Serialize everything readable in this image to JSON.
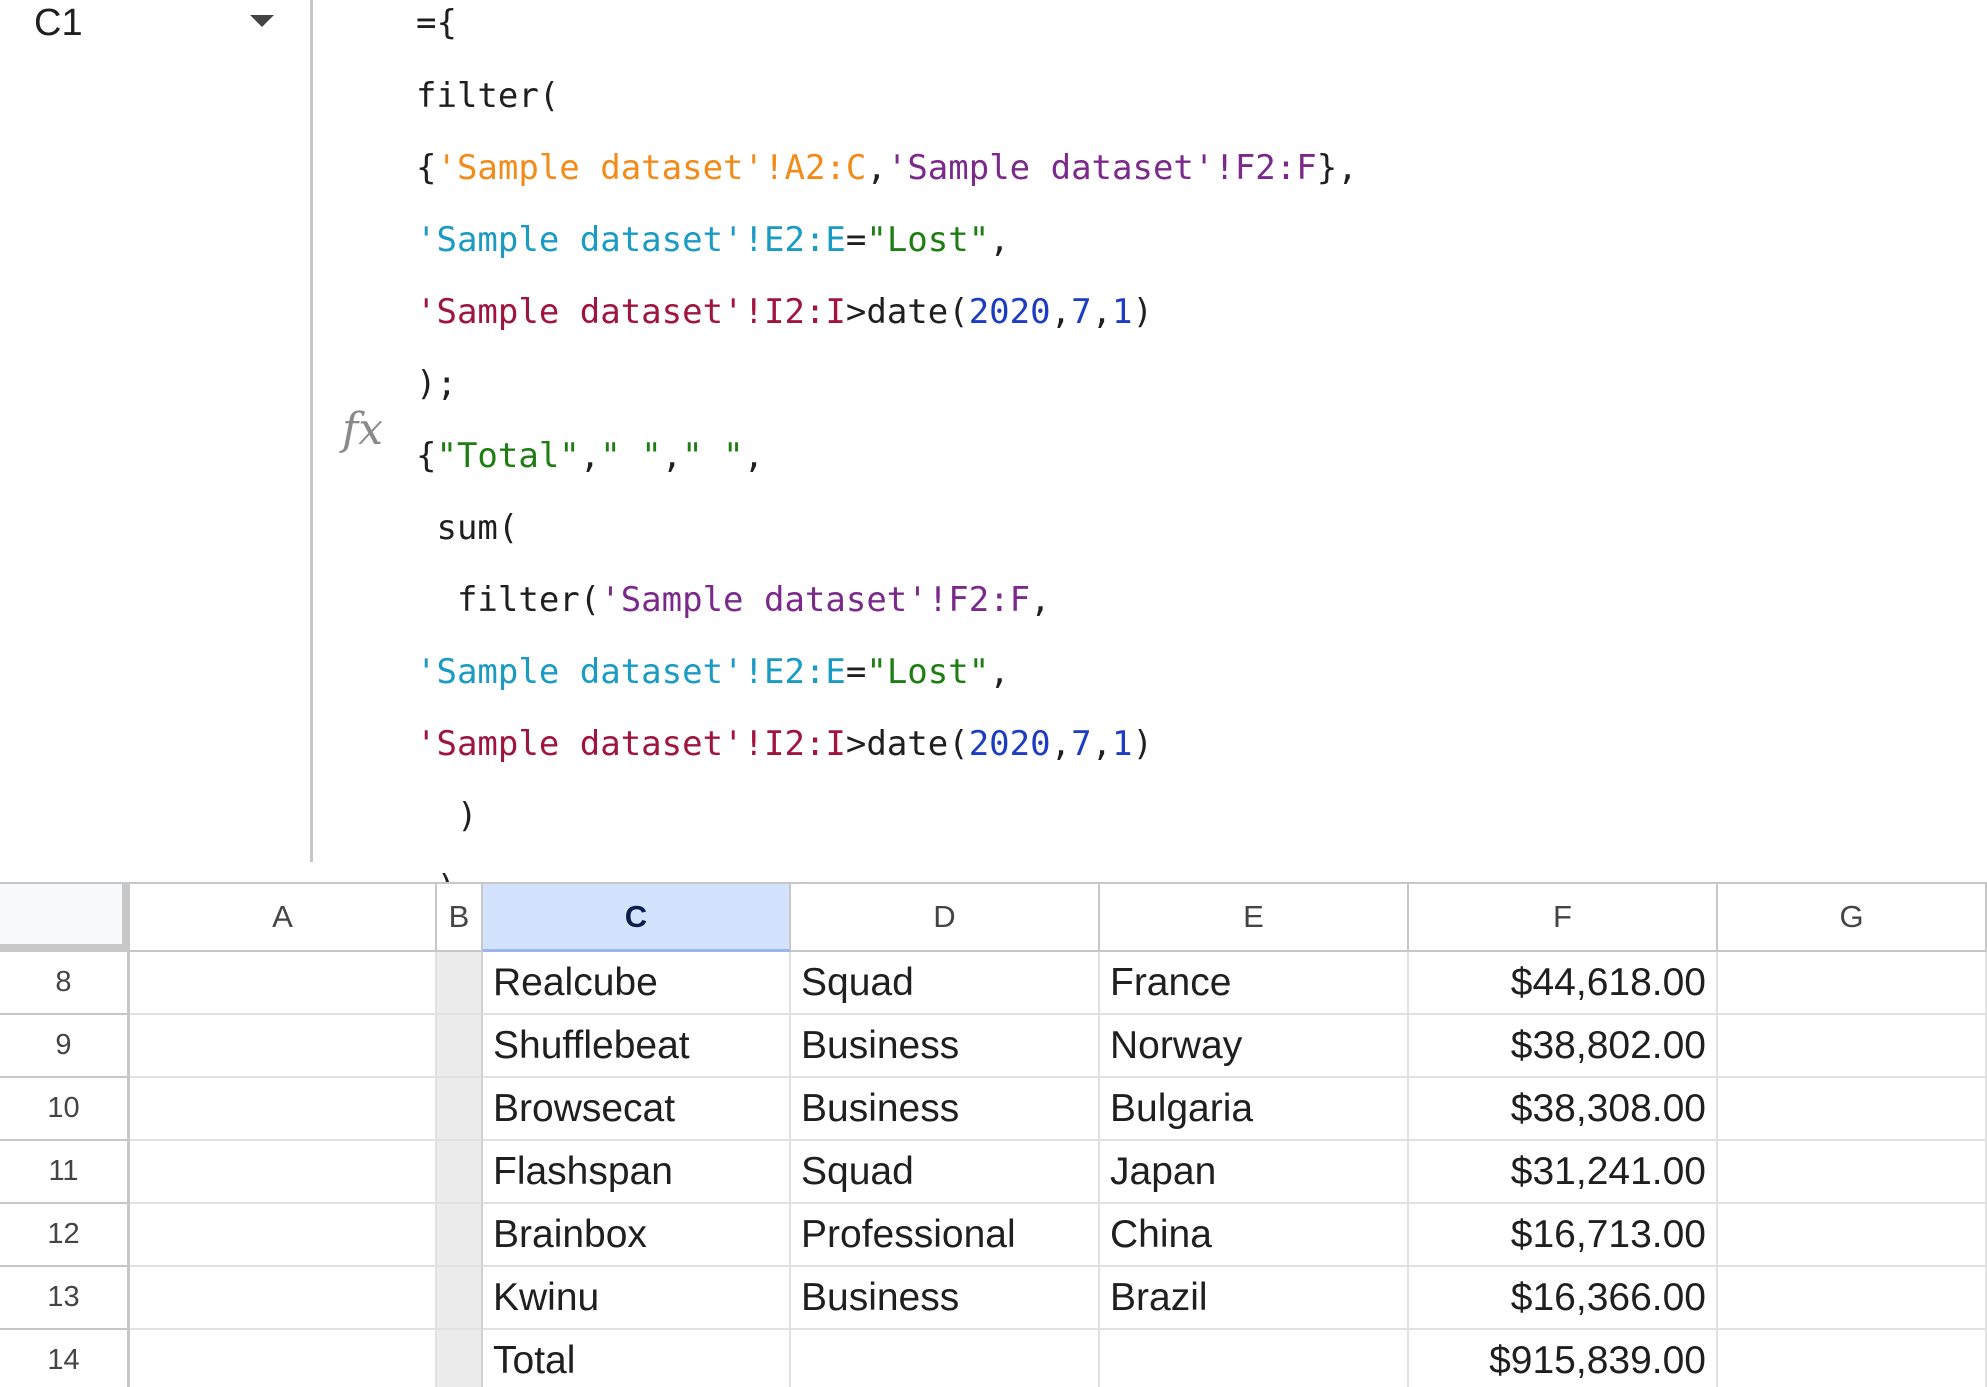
{
  "name_box": {
    "cell_ref": "C1"
  },
  "formula_bar": {
    "fx_icon": "fx",
    "lines": [
      [
        {
          "t": "={",
          "c": "black"
        }
      ],
      [
        {
          "t": "filter(",
          "c": "black"
        }
      ],
      [
        {
          "t": "{",
          "c": "black"
        },
        {
          "t": "'Sample dataset'!A2:C",
          "c": "orange"
        },
        {
          "t": ",",
          "c": "black"
        },
        {
          "t": "'Sample dataset'!F2:F",
          "c": "purple"
        },
        {
          "t": "},",
          "c": "black"
        }
      ],
      [
        {
          "t": "'Sample dataset'!E2:E",
          "c": "teal"
        },
        {
          "t": "=",
          "c": "black"
        },
        {
          "t": "\"Lost\"",
          "c": "green"
        },
        {
          "t": ",",
          "c": "black"
        }
      ],
      [
        {
          "t": "'Sample dataset'!I2:I",
          "c": "maroon"
        },
        {
          "t": ">date(",
          "c": "black"
        },
        {
          "t": "2020",
          "c": "blue"
        },
        {
          "t": ",",
          "c": "black"
        },
        {
          "t": "7",
          "c": "blue"
        },
        {
          "t": ",",
          "c": "black"
        },
        {
          "t": "1",
          "c": "blue"
        },
        {
          "t": ")",
          "c": "black"
        }
      ],
      [
        {
          "t": ");",
          "c": "black"
        }
      ],
      [
        {
          "t": "{",
          "c": "black"
        },
        {
          "t": "\"Total\"",
          "c": "green"
        },
        {
          "t": ",",
          "c": "black"
        },
        {
          "t": "\" \"",
          "c": "green"
        },
        {
          "t": ",",
          "c": "black"
        },
        {
          "t": "\" \"",
          "c": "green"
        },
        {
          "t": ",",
          "c": "black"
        }
      ],
      [
        {
          "t": " sum(",
          "c": "black"
        }
      ],
      [
        {
          "t": "  filter(",
          "c": "black"
        },
        {
          "t": "'Sample dataset'!F2:F",
          "c": "purple"
        },
        {
          "t": ",",
          "c": "black"
        }
      ],
      [
        {
          "t": "'Sample dataset'!E2:E",
          "c": "teal"
        },
        {
          "t": "=",
          "c": "black"
        },
        {
          "t": "\"Lost\"",
          "c": "green"
        },
        {
          "t": ",",
          "c": "black"
        }
      ],
      [
        {
          "t": "'Sample dataset'!I2:I",
          "c": "maroon"
        },
        {
          "t": ">date(",
          "c": "black"
        },
        {
          "t": "2020",
          "c": "blue"
        },
        {
          "t": ",",
          "c": "black"
        },
        {
          "t": "7",
          "c": "blue"
        },
        {
          "t": ",",
          "c": "black"
        },
        {
          "t": "1",
          "c": "blue"
        },
        {
          "t": ")",
          "c": "black"
        }
      ],
      [
        {
          "t": "  )",
          "c": "black"
        }
      ],
      [
        {
          "t": " )",
          "c": "black"
        }
      ]
    ]
  },
  "grid": {
    "columns": [
      {
        "key": "A",
        "label": "A"
      },
      {
        "key": "B",
        "label": "B"
      },
      {
        "key": "C",
        "label": "C",
        "selected": true
      },
      {
        "key": "D",
        "label": "D"
      },
      {
        "key": "E",
        "label": "E"
      },
      {
        "key": "F",
        "label": "F"
      },
      {
        "key": "G",
        "label": "G"
      }
    ],
    "rows": [
      {
        "num": "8",
        "C": "Realcube",
        "D": "Squad",
        "E": "France",
        "F": "$44,618.00"
      },
      {
        "num": "9",
        "C": "Shufflebeat",
        "D": "Business",
        "E": "Norway",
        "F": "$38,802.00"
      },
      {
        "num": "10",
        "C": "Browsecat",
        "D": "Business",
        "E": "Bulgaria",
        "F": "$38,308.00"
      },
      {
        "num": "11",
        "C": "Flashspan",
        "D": "Squad",
        "E": "Japan",
        "F": "$31,241.00"
      },
      {
        "num": "12",
        "C": "Brainbox",
        "D": "Professional",
        "E": "China",
        "F": "$16,713.00"
      },
      {
        "num": "13",
        "C": "Kwinu",
        "D": "Business",
        "E": "Brazil",
        "F": "$16,366.00"
      },
      {
        "num": "14",
        "C": "Total",
        "D": "",
        "E": "",
        "F": "$915,839.00"
      }
    ]
  }
}
